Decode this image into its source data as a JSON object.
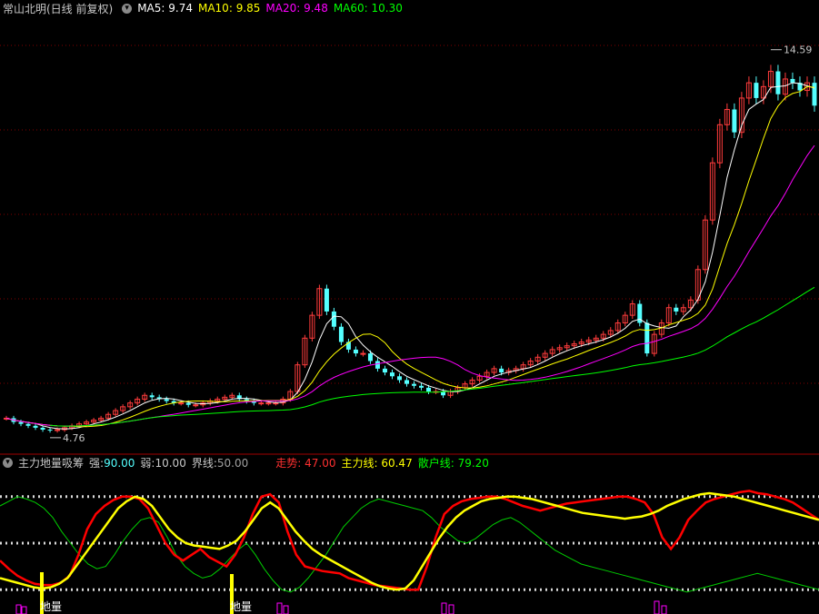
{
  "title": "常山北明(日线 前复权)",
  "ma": [
    {
      "label": "MA5:",
      "value": "9.74",
      "color": "#ffffff"
    },
    {
      "label": "MA10:",
      "value": "9.85",
      "color": "#ffff00"
    },
    {
      "label": "MA20:",
      "value": "9.48",
      "color": "#ff00ff"
    },
    {
      "label": "MA60:",
      "value": "10.30",
      "color": "#00ff00"
    }
  ],
  "indicator": {
    "name": "主力地量吸筹",
    "strong_label": "强:",
    "strong_value": "90.00",
    "weak_label": "弱:",
    "weak_value": "10.00",
    "boundary_label": "界线:",
    "boundary_value": "50.00",
    "trend_label": "走势:",
    "trend_value": "47.00",
    "main_label": "主力线:",
    "main_value": "60.47",
    "retail_label": "散户线:",
    "retail_value": "79.20",
    "tag": "地量"
  },
  "chart_data": [
    {
      "type": "line",
      "name": "price",
      "annotations": [
        {
          "label": "14.59"
        },
        {
          "label": "4.76"
        }
      ],
      "price_range": [
        4.3,
        15.5
      ],
      "close": [
        5.1,
        5.0,
        4.95,
        4.9,
        4.85,
        4.8,
        4.78,
        4.8,
        4.85,
        4.9,
        4.95,
        5.0,
        5.05,
        5.1,
        5.2,
        5.3,
        5.4,
        5.5,
        5.6,
        5.7,
        5.65,
        5.6,
        5.55,
        5.5,
        5.5,
        5.45,
        5.45,
        5.5,
        5.55,
        5.6,
        5.65,
        5.7,
        5.6,
        5.55,
        5.5,
        5.5,
        5.5,
        5.5,
        5.6,
        5.8,
        6.5,
        7.2,
        7.8,
        8.5,
        7.9,
        7.5,
        7.1,
        6.9,
        6.8,
        6.8,
        6.6,
        6.4,
        6.3,
        6.2,
        6.1,
        6.0,
        5.95,
        5.9,
        5.8,
        5.8,
        5.7,
        5.8,
        5.9,
        6.0,
        6.1,
        6.2,
        6.3,
        6.4,
        6.3,
        6.35,
        6.4,
        6.5,
        6.6,
        6.7,
        6.8,
        6.9,
        6.95,
        7.0,
        7.05,
        7.1,
        7.15,
        7.2,
        7.3,
        7.4,
        7.6,
        7.8,
        8.1,
        7.6,
        6.8,
        7.3,
        7.6,
        8.0,
        7.9,
        8.0,
        8.2,
        9.0,
        10.3,
        11.8,
        12.8,
        13.2,
        12.6,
        13.5,
        13.9,
        13.5,
        13.8,
        14.2,
        13.6,
        14.0,
        13.9,
        13.7,
        13.9,
        13.3
      ]
    },
    {
      "type": "line",
      "name": "indicator",
      "y_range": [
        0,
        100
      ],
      "levels": [
        90,
        50,
        10
      ],
      "trend": [
        35,
        28,
        22,
        18,
        15,
        14,
        14,
        16,
        22,
        40,
        62,
        75,
        82,
        87,
        90,
        90,
        88,
        80,
        65,
        50,
        40,
        35,
        40,
        45,
        38,
        34,
        30,
        40,
        55,
        75,
        90,
        92,
        85,
        60,
        40,
        30,
        28,
        26,
        25,
        24,
        20,
        18,
        16,
        14,
        13,
        12,
        11,
        10,
        10,
        30,
        55,
        75,
        82,
        86,
        88,
        89,
        90,
        90,
        88,
        85,
        82,
        80,
        78,
        80,
        82,
        84,
        85,
        86,
        87,
        88,
        89,
        90,
        90,
        88,
        85,
        75,
        55,
        45,
        55,
        70,
        78,
        85,
        88,
        90,
        92,
        94,
        95,
        93,
        92,
        90,
        88,
        85,
        80,
        75,
        70
      ],
      "main": [
        20,
        18,
        16,
        14,
        12,
        11,
        12,
        15,
        20,
        30,
        40,
        50,
        60,
        70,
        80,
        86,
        90,
        88,
        82,
        72,
        62,
        55,
        50,
        48,
        47,
        46,
        45,
        48,
        52,
        60,
        70,
        80,
        85,
        80,
        70,
        60,
        52,
        45,
        40,
        36,
        32,
        28,
        24,
        20,
        16,
        13,
        11,
        10,
        11,
        18,
        30,
        42,
        54,
        64,
        72,
        78,
        82,
        86,
        88,
        89,
        90,
        90,
        89,
        88,
        86,
        84,
        82,
        80,
        78,
        76,
        75,
        74,
        73,
        72,
        71,
        72,
        73,
        75,
        78,
        82,
        85,
        88,
        90,
        92,
        93,
        92,
        91,
        90,
        88,
        86,
        84,
        82,
        80,
        78,
        76,
        74,
        72,
        70
      ],
      "retail": [
        82,
        86,
        90,
        88,
        85,
        80,
        72,
        60,
        50,
        40,
        32,
        28,
        30,
        40,
        52,
        62,
        70,
        72,
        68,
        55,
        40,
        30,
        24,
        20,
        22,
        28,
        36,
        44,
        50,
        40,
        28,
        18,
        10,
        8,
        12,
        20,
        30,
        40,
        52,
        64,
        72,
        80,
        85,
        88,
        86,
        84,
        82,
        80,
        78,
        72,
        64,
        58,
        52,
        50,
        54,
        60,
        66,
        70,
        72,
        68,
        62,
        56,
        50,
        44,
        40,
        36,
        32,
        30,
        28,
        26,
        24,
        22,
        20,
        18,
        16,
        14,
        12,
        10,
        8,
        10,
        12,
        14,
        16,
        18,
        20,
        22,
        24,
        22,
        20,
        18,
        16,
        14,
        12,
        10
      ]
    }
  ],
  "colors": {
    "up": "#ff3c3c",
    "down": "#54ffff",
    "ma5": "#ffffff",
    "ma10": "#ffff00",
    "ma20": "#ff00ff",
    "ma60": "#00ff00",
    "trend": "#ff0000",
    "main": "#ffff00",
    "retail": "#00cc00",
    "grid": "#800000"
  }
}
